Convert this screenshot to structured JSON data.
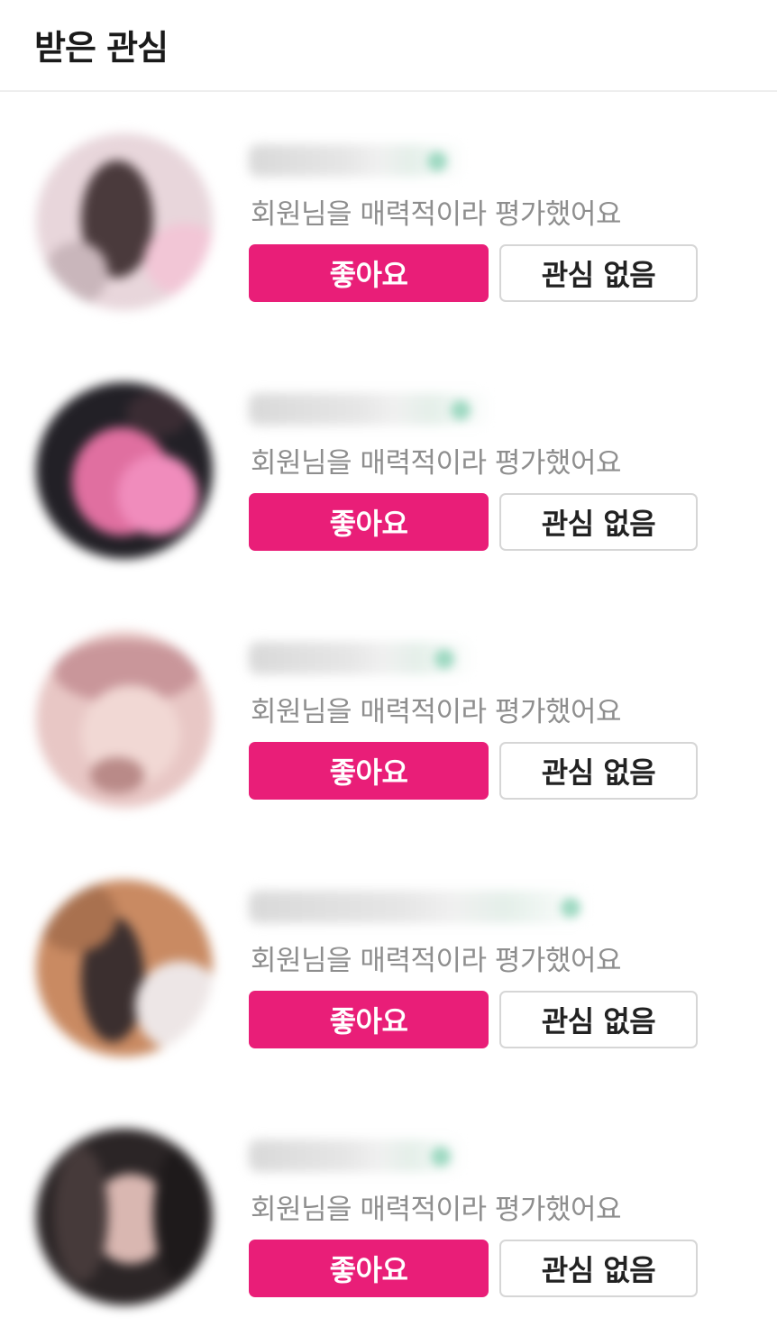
{
  "header": {
    "title": "받은 관심"
  },
  "items": [
    {
      "message": "회원님을 매력적이라 평가했어요",
      "like_label": "좋아요",
      "pass_label": "관심 없음",
      "avatar_colors": [
        "#e8d6db",
        "#4a3a3c",
        "#f2c6d6",
        "#c9b6bb"
      ]
    },
    {
      "message": "회원님을 매력적이라 평가했어요",
      "like_label": "좋아요",
      "pass_label": "관심 없음",
      "avatar_colors": [
        "#222026",
        "#e06fa0",
        "#f08cbc",
        "#3a2c33"
      ]
    },
    {
      "message": "회원님을 매력적이라 평가했어요",
      "like_label": "좋아요",
      "pass_label": "관심 없음",
      "avatar_colors": [
        "#e8c7c5",
        "#c9969a",
        "#f1d8d4",
        "#b98a88"
      ]
    },
    {
      "message": "회원님을 매력적이라 평가했어요",
      "like_label": "좋아요",
      "pass_label": "관심 없음",
      "avatar_colors": [
        "#c98a62",
        "#3b2f2f",
        "#ede6e6",
        "#a9714f"
      ]
    },
    {
      "message": "회원님을 매력적이라 평가했어요",
      "like_label": "좋아요",
      "pass_label": "관심 없음",
      "avatar_colors": [
        "#2b2526",
        "#d9b7b1",
        "#463a3a",
        "#1e1a1b"
      ]
    }
  ],
  "colors": {
    "accent": "#e91e78",
    "message_text": "#8e8e8e",
    "button_border": "#d6d6d6"
  }
}
